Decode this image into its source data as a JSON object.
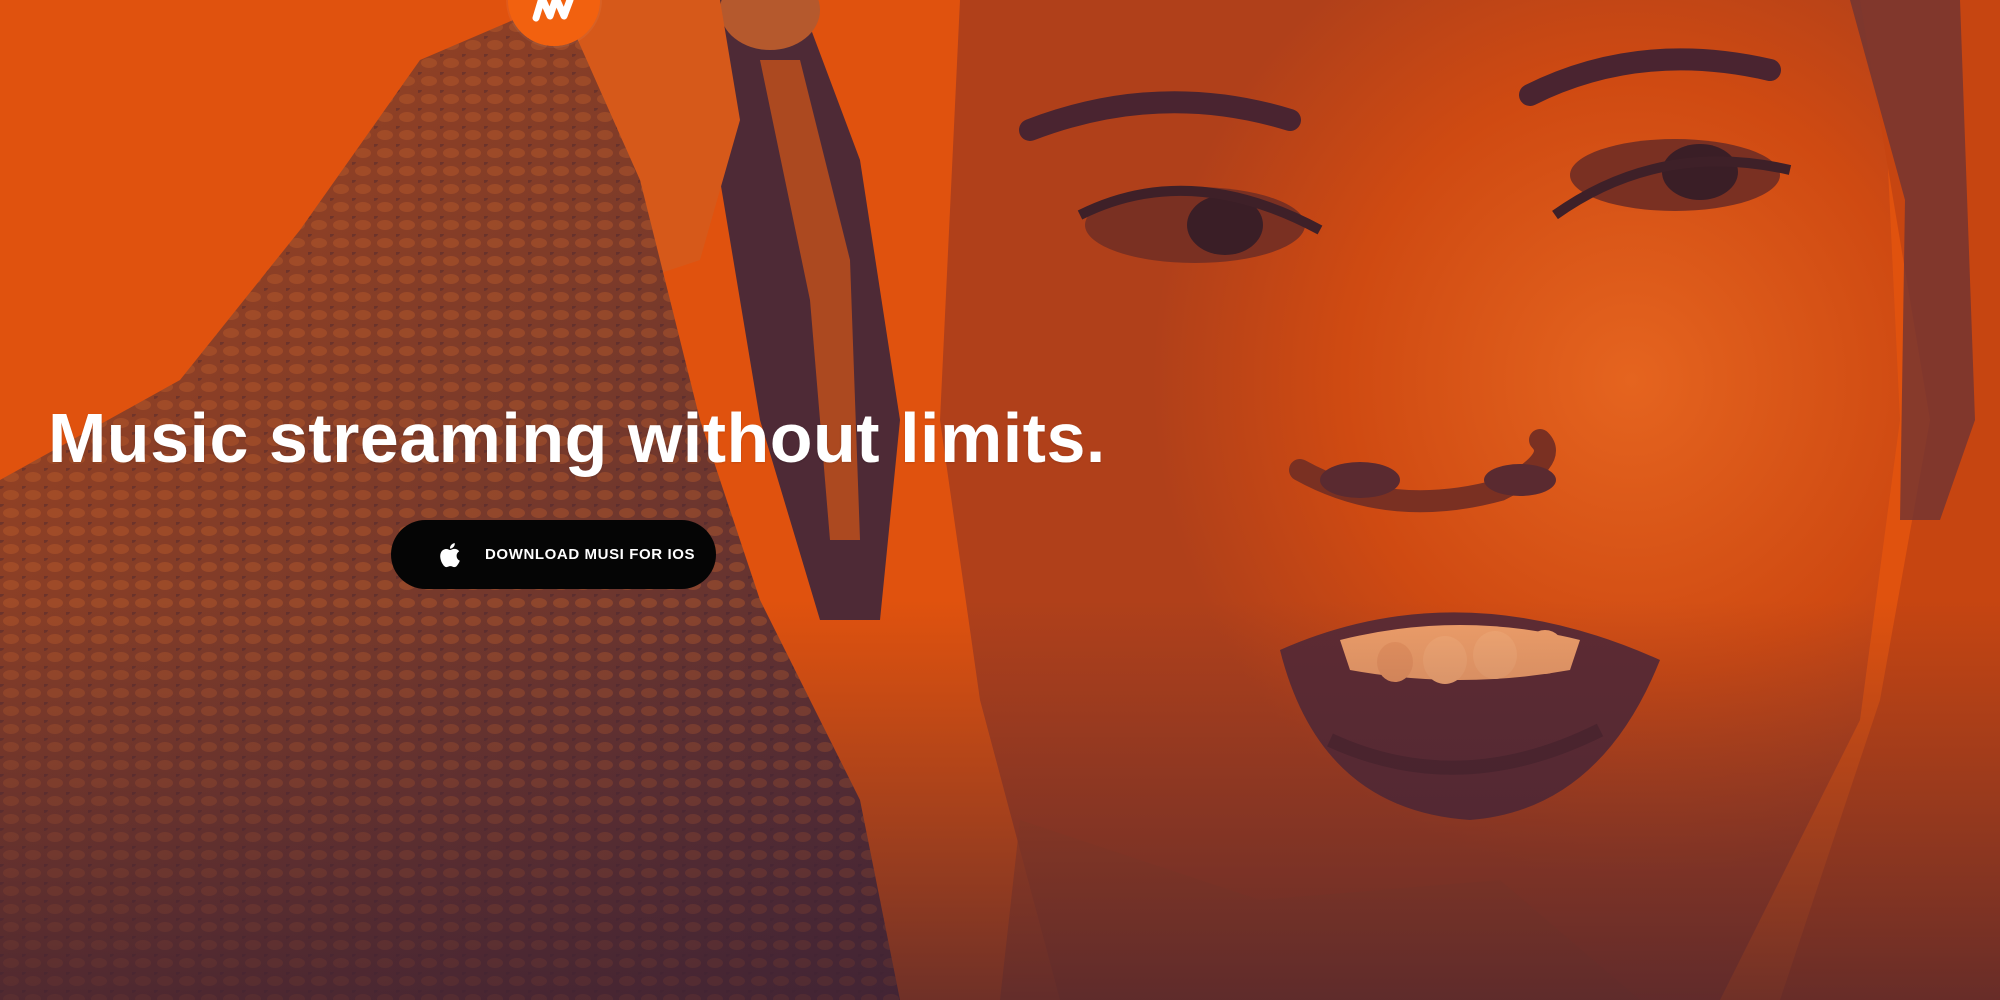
{
  "hero": {
    "headline": "Music streaming without limits.",
    "photo": "woman-with-headphones-photo",
    "tint_color": "#e0520e",
    "shadow_color": "#5a2a36"
  },
  "logo": {
    "icon": "musi-logo-icon",
    "color": "#f2610f"
  },
  "cta": {
    "label": "DOWNLOAD MUSI FOR IOS",
    "icon": "apple-icon",
    "background": "#050505"
  }
}
